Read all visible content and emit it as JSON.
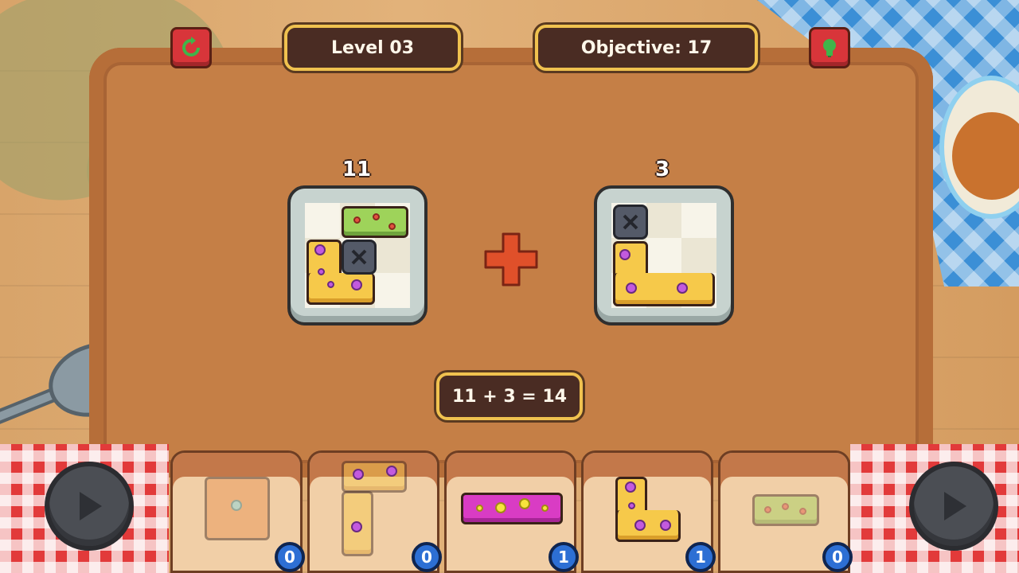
{
  "hud": {
    "level_label": "Level 03",
    "objective_label": "Objective: 17",
    "restart_icon": "restart-icon",
    "hint_icon": "lightbulb-icon"
  },
  "puzzle": {
    "left_score": "11",
    "right_score": "3",
    "operator_icon": "plus-icon",
    "equation": "11 + 3 = 14"
  },
  "inventory": {
    "slots": [
      {
        "piece": "single-square",
        "count": "0"
      },
      {
        "piece": "t-shape",
        "count": "0"
      },
      {
        "piece": "long-bar-magenta",
        "count": "1"
      },
      {
        "piece": "l-shape-yellow",
        "count": "1"
      },
      {
        "piece": "bar-green",
        "count": "0"
      }
    ]
  },
  "colors": {
    "hud_bg": "#4a2c23",
    "hud_border": "#f0c24f",
    "red_button": "#d8353a",
    "count_badge": "#2d6fd4"
  }
}
